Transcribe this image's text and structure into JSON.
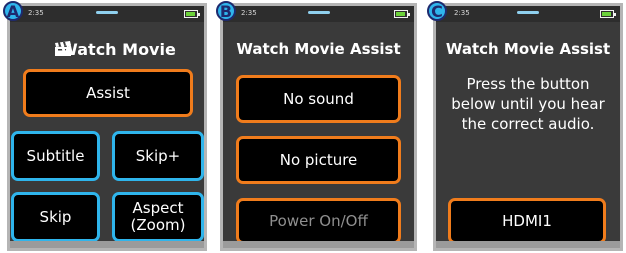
{
  "colors": {
    "accent_orange": "#f07c1c",
    "accent_blue": "#2fb5ec",
    "screen_bg": "#3a3a3a",
    "battery_green": "#6cd23a"
  },
  "battery_level": 0.85,
  "panels": [
    {
      "badge": "A",
      "time": "2:35",
      "title": "Watch Movie",
      "title_icon": "clapperboard-icon",
      "buttons": {
        "assist": "Assist",
        "subtitle": "Subtitle",
        "skip_plus": "Skip+",
        "skip": "Skip",
        "aspect_line1": "Aspect",
        "aspect_line2": "(Zoom)"
      }
    },
    {
      "badge": "B",
      "time": "2:35",
      "title": "Watch Movie Assist",
      "buttons": {
        "no_sound": "No sound",
        "no_picture": "No picture",
        "power": "Power On/Off"
      }
    },
    {
      "badge": "C",
      "time": "2:35",
      "title": "Watch Movie Assist",
      "instructions": "Press the button below until you hear the correct audio.",
      "buttons": {
        "hdmi": "HDMI1"
      }
    }
  ]
}
